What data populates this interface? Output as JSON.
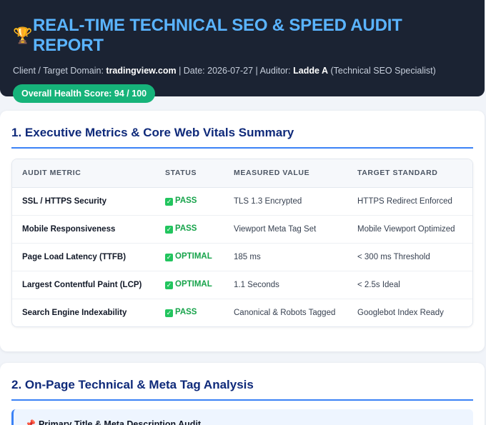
{
  "header": {
    "icon": "trophy-icon",
    "title": "REAL-TIME TECHNICAL SEO & SPEED AUDIT REPORT",
    "client_label": "Client / Target Domain:",
    "domain": "tradingview.com",
    "date_label": "| Date: 2026-07-27 | Auditor:",
    "auditor": "Ladde A",
    "auditor_role": "(Technical SEO Specialist)",
    "health_score": "Overall Health Score: 94 / 100"
  },
  "section1": {
    "title": "1. Executive Metrics & Core Web Vitals Summary",
    "columns": [
      "AUDIT METRIC",
      "STATUS",
      "MEASURED VALUE",
      "TARGET STANDARD"
    ],
    "rows": [
      {
        "metric": "SSL / HTTPS Security",
        "status": "PASS",
        "value": "TLS 1.3 Encrypted",
        "target": "HTTPS Redirect Enforced"
      },
      {
        "metric": "Mobile Responsiveness",
        "status": "PASS",
        "value": "Viewport Meta Tag Set",
        "target": "Mobile Viewport Optimized"
      },
      {
        "metric": "Page Load Latency (TTFB)",
        "status": "OPTIMAL",
        "value": "185 ms",
        "target": "< 300 ms Threshold"
      },
      {
        "metric": "Largest Contentful Paint (LCP)",
        "status": "OPTIMAL",
        "value": "1.1 Seconds",
        "target": "< 2.5s Ideal"
      },
      {
        "metric": "Search Engine Indexability",
        "status": "PASS",
        "value": "Canonical & Robots Tagged",
        "target": "Googlebot Index Ready"
      }
    ]
  },
  "section2": {
    "title": "2. On-Page Technical & Meta Tag Analysis",
    "subcard_title": "Primary Title & Meta Description Audit"
  },
  "colors": {
    "header_bg": "#1b2333",
    "title_blue": "#5ab4ff",
    "score_green": "#16b37a",
    "section_title": "#0f2a7a",
    "pass_green": "#16a34a"
  }
}
